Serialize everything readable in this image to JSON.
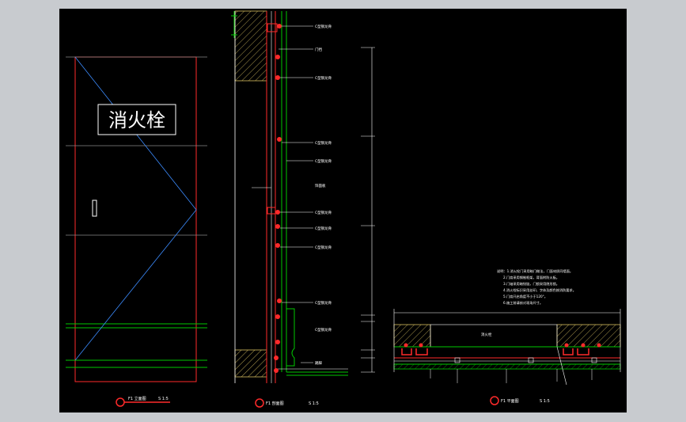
{
  "viewport": {
    "background": "#c8cbcf",
    "canvas": "#000000"
  },
  "colors": {
    "red": "#ff2a2a",
    "green": "#00c800",
    "white": "#ffffff",
    "hatch": "#d8c060",
    "dim": "#b0b0b0"
  },
  "elevation": {
    "sign_text": "消火栓",
    "title": "F1 立面图",
    "scale": "S 1:5"
  },
  "section": {
    "title": "F1 剖面图",
    "scale": "S 1:5",
    "labels": [
      "C型钢龙骨",
      "门挡",
      "C型钢龙骨",
      "C型钢龙骨",
      "C型钢龙骨",
      "饰面板",
      "C型钢龙骨",
      "C型钢龙骨",
      "C型钢龙骨",
      "C型钢龙骨",
      "C型钢龙骨",
      "踢脚"
    ]
  },
  "plan": {
    "title": "F1 平面图",
    "scale": "S 1:5",
    "room_label": "消火栓",
    "notes": [
      "说明：1.消火栓门采用暗门做法，门面材质同墙面。",
      "2.门扇采用钢制框架，背面附防火板。",
      "3.门轴采用暗铰链，门锁采用隐形锁。",
      "4.消火栓标识采用丝印，字体及颜色按消防要求。",
      "5.门扇开启角度不小于120°。",
      "6.施工前请核对现场尺寸。"
    ]
  }
}
